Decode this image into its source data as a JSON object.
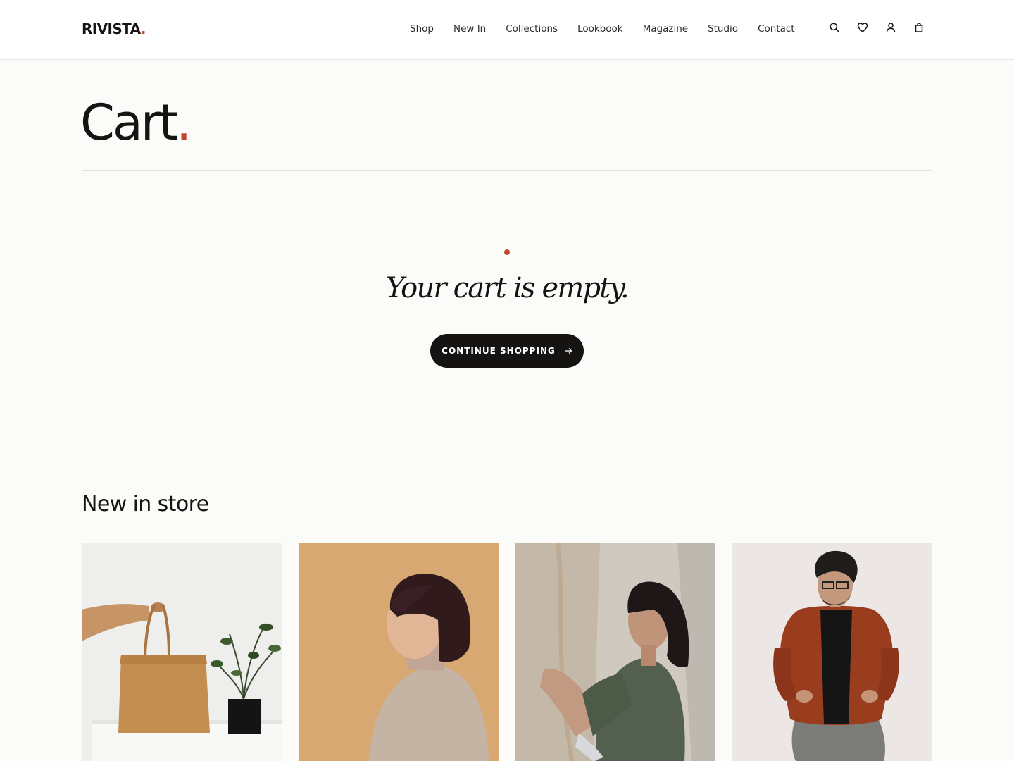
{
  "brand": {
    "name": "RIVISTA",
    "dot": ".",
    "accent_color": "#c0462b"
  },
  "nav": {
    "items": [
      {
        "label": "Shop"
      },
      {
        "label": "New In"
      },
      {
        "label": "Collections"
      },
      {
        "label": "Lookbook"
      },
      {
        "label": "Magazine"
      },
      {
        "label": "Studio"
      },
      {
        "label": "Contact"
      }
    ]
  },
  "header_icons": [
    "search-icon",
    "heart-icon",
    "user-icon",
    "bag-icon"
  ],
  "page": {
    "title": "Cart",
    "title_dot": "."
  },
  "empty_state": {
    "message": "Your cart is empty.",
    "button_label": "CONTINUE SHOPPING",
    "button_icon": "arrow-right-icon"
  },
  "new_in": {
    "title": "New in store",
    "products": [
      {
        "image": "tote-bag-with-plant"
      },
      {
        "image": "woman-bob-haircut-sweater"
      },
      {
        "image": "woman-green-cardigan"
      },
      {
        "image": "man-rust-jacket"
      }
    ]
  }
}
